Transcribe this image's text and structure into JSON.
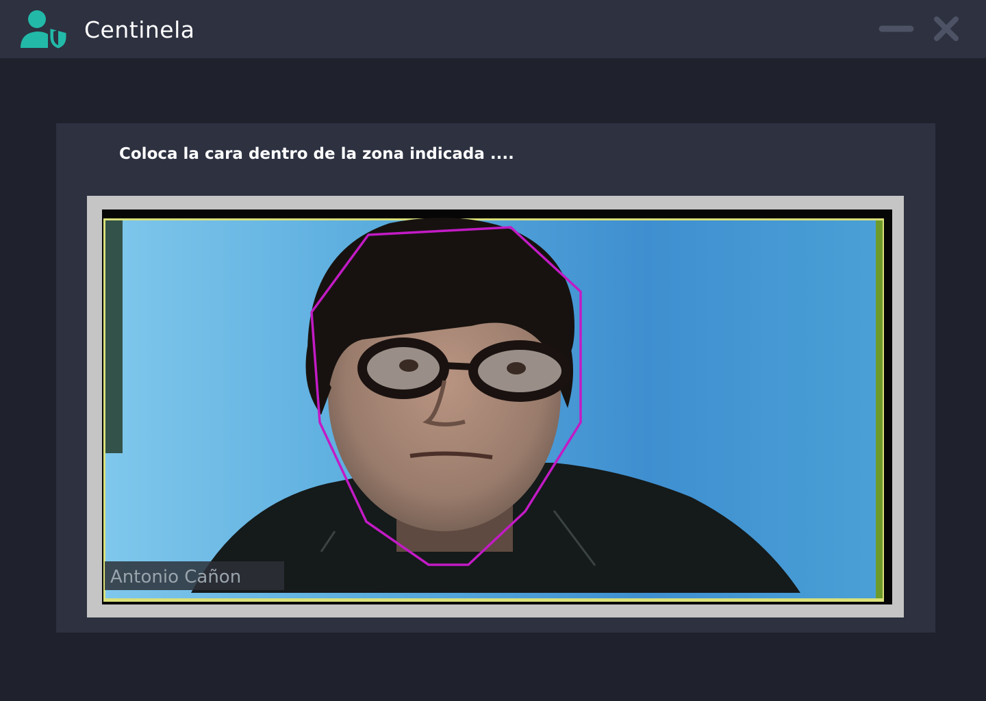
{
  "app": {
    "title": "Centinela",
    "logo_icon": "user-shield-icon",
    "accent_color": "#22b9a8"
  },
  "window_controls": {
    "minimize_icon": "minimize-icon",
    "close_icon": "close-icon"
  },
  "capture": {
    "instruction": "Coloca la cara dentro de la zona indicada ....",
    "participant_name": "Antonio Cañon",
    "overlay_color": "#c21bc5",
    "frame_border_color": "#c5c5c5",
    "feed_border_color": "#d9e07a"
  }
}
